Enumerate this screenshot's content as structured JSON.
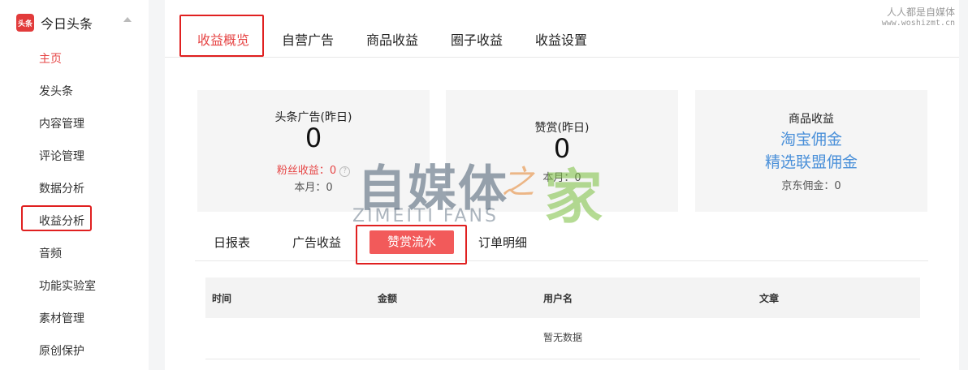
{
  "sidebar": {
    "brand_logo_text": "头条",
    "brand_name": "今日头条",
    "items": [
      {
        "label": "主页"
      },
      {
        "label": "发头条"
      },
      {
        "label": "内容管理"
      },
      {
        "label": "评论管理"
      },
      {
        "label": "数据分析"
      },
      {
        "label": "收益分析"
      },
      {
        "label": "音频"
      },
      {
        "label": "功能实验室"
      },
      {
        "label": "素材管理"
      },
      {
        "label": "原创保护"
      }
    ]
  },
  "top_tabs": [
    {
      "label": "收益概览"
    },
    {
      "label": "自营广告"
    },
    {
      "label": "商品收益"
    },
    {
      "label": "圈子收益"
    },
    {
      "label": "收益设置"
    }
  ],
  "cards": {
    "ads": {
      "title": "头条广告(昨日)",
      "value": "0",
      "fans_label": "粉丝收益：0",
      "month": "本月：0"
    },
    "reward": {
      "title": "赞赏(昨日)",
      "value": "0",
      "month": "本月：0"
    },
    "goods": {
      "title": "商品收益",
      "link1": "淘宝佣金",
      "link2": "精选联盟佣金",
      "jd": "京东佣金：0"
    }
  },
  "sub_tabs": [
    {
      "label": "日报表"
    },
    {
      "label": "广告收益"
    },
    {
      "label": "赞赏流水"
    },
    {
      "label": "订单明细"
    }
  ],
  "table": {
    "columns": [
      "时间",
      "金额",
      "用户名",
      "文章"
    ],
    "empty": "暂无数据"
  },
  "watermark": {
    "main": "自媒体",
    "zhi": "之",
    "jia": "家",
    "fans": "ZIMEITI FANS"
  },
  "corner": {
    "line1": "人人都是自媒体",
    "line2": "www.woshizmt.cn"
  },
  "colors": {
    "accent": "#e64545",
    "link": "#4a90d9",
    "active_tab_bg": "#f25a5a"
  }
}
